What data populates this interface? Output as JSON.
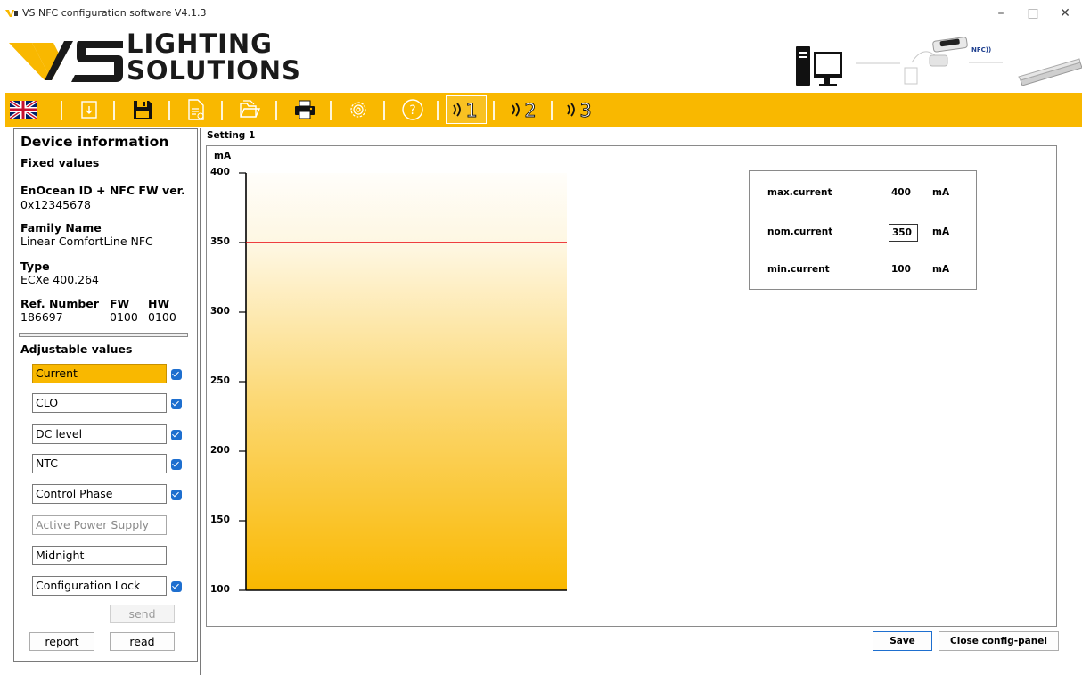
{
  "window": {
    "title": "VS NFC configuration software V4.1.3",
    "minimize_glyph": "–",
    "maximize_glyph": "□",
    "close_glyph": "✕"
  },
  "header": {
    "logo_line1": "LIGHTING",
    "logo_line2": "SOLUTIONS",
    "nfc_badge": "NFC))"
  },
  "toolbar": {
    "icons": [
      "uk-flag-icon",
      "import-icon",
      "save-icon",
      "new-document-icon",
      "open-folder-icon",
      "print-icon",
      "settings-gear-icon",
      "help-icon",
      "nfc-setting-1-icon",
      "nfc-setting-2-icon",
      "nfc-setting-3-icon"
    ],
    "setting_1": "1",
    "setting_2": "2",
    "setting_3": "3",
    "help_glyph": "?"
  },
  "device_info": {
    "title": "Device information",
    "fixed_values_label": "Fixed values",
    "enocean_label": "EnOcean ID + NFC FW ver.",
    "enocean_value": "0x12345678",
    "family_label": "Family Name",
    "family_value": "Linear ComfortLine NFC",
    "type_label": "Type",
    "type_value": "ECXe 400.264",
    "ref_label": "Ref. Number",
    "ref_value": "186697",
    "fw_label": "FW",
    "fw_value": "0100",
    "hw_label": "HW",
    "hw_value": "0100",
    "adjustable_label": "Adjustable values"
  },
  "adjustable_items": [
    {
      "label": "Current",
      "checked": true,
      "selected": true
    },
    {
      "label": "CLO",
      "checked": true
    },
    {
      "label": "DC level",
      "checked": true
    },
    {
      "label": "NTC",
      "checked": true
    },
    {
      "label": "Control Phase",
      "checked": true
    },
    {
      "label": "Active Power Supply",
      "checked": false,
      "disabled": true
    },
    {
      "label": "Midnight",
      "checked": false
    },
    {
      "label": "Configuration Lock",
      "checked": true
    }
  ],
  "buttons": {
    "send": "send",
    "report": "report",
    "read": "read",
    "save": "Save",
    "close_panel": "Close config-panel"
  },
  "setting_panel": {
    "title": "Setting 1",
    "max_label": "max.current",
    "max_value": "400",
    "nom_label": "nom.current",
    "nom_value": "350",
    "min_label": "min.current",
    "min_value": "100",
    "unit": "mA"
  },
  "colors": {
    "accent": "#F9B800",
    "nominal_line": "#E8000B",
    "checkbox": "#1E6FCF"
  },
  "chart_data": {
    "type": "bar",
    "ylabel": "mA",
    "ylim": [
      100,
      400
    ],
    "yticks": [
      400,
      350,
      300,
      250,
      200,
      150,
      100
    ],
    "max_current": 400,
    "nominal_current": 350,
    "min_current": 100
  }
}
